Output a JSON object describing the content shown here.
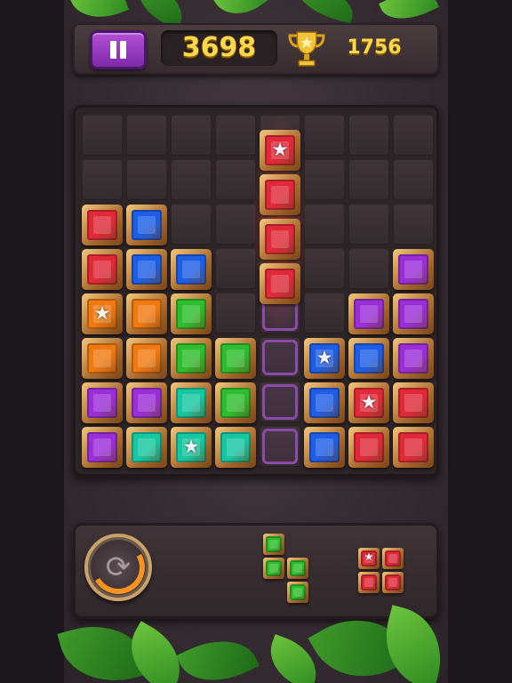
{
  "header": {
    "pause_icon": "pause-icon",
    "score": "3698",
    "trophy_icon": "trophy-icon",
    "best_score": "1756"
  },
  "colors": {
    "red": "#e02a3a",
    "blue": "#1e5ee6",
    "purple": "#9a2fd8",
    "orange": "#f07a12",
    "green": "#2ebd2e",
    "teal": "#17c7a2",
    "ghost": "#8a4aa8",
    "gold": "#ffd84a",
    "pause": "#9b3cc4",
    "rotate_accent": "#f7931e"
  },
  "board": {
    "rows": 8,
    "cols": 8,
    "placed": [
      {
        "row": 2,
        "col": 0,
        "color": "red"
      },
      {
        "row": 2,
        "col": 1,
        "color": "blue"
      },
      {
        "row": 3,
        "col": 0,
        "color": "red"
      },
      {
        "row": 3,
        "col": 1,
        "color": "blue"
      },
      {
        "row": 3,
        "col": 2,
        "color": "blue"
      },
      {
        "row": 3,
        "col": 7,
        "color": "purple"
      },
      {
        "row": 4,
        "col": 0,
        "color": "orange",
        "star": true
      },
      {
        "row": 4,
        "col": 1,
        "color": "orange"
      },
      {
        "row": 4,
        "col": 2,
        "color": "green"
      },
      {
        "row": 4,
        "col": 6,
        "color": "purple"
      },
      {
        "row": 4,
        "col": 7,
        "color": "purple"
      },
      {
        "row": 5,
        "col": 0,
        "color": "orange"
      },
      {
        "row": 5,
        "col": 1,
        "color": "orange"
      },
      {
        "row": 5,
        "col": 2,
        "color": "green"
      },
      {
        "row": 5,
        "col": 3,
        "color": "green"
      },
      {
        "row": 5,
        "col": 5,
        "color": "blue",
        "star": true
      },
      {
        "row": 5,
        "col": 6,
        "color": "blue"
      },
      {
        "row": 5,
        "col": 7,
        "color": "purple"
      },
      {
        "row": 6,
        "col": 0,
        "color": "purple"
      },
      {
        "row": 6,
        "col": 1,
        "color": "purple"
      },
      {
        "row": 6,
        "col": 2,
        "color": "teal"
      },
      {
        "row": 6,
        "col": 3,
        "color": "green"
      },
      {
        "row": 6,
        "col": 5,
        "color": "blue"
      },
      {
        "row": 6,
        "col": 6,
        "color": "red",
        "star": true
      },
      {
        "row": 6,
        "col": 7,
        "color": "red"
      },
      {
        "row": 7,
        "col": 0,
        "color": "purple"
      },
      {
        "row": 7,
        "col": 1,
        "color": "teal"
      },
      {
        "row": 7,
        "col": 2,
        "color": "teal",
        "star": true
      },
      {
        "row": 7,
        "col": 3,
        "color": "teal"
      },
      {
        "row": 7,
        "col": 5,
        "color": "blue"
      },
      {
        "row": 7,
        "col": 6,
        "color": "red"
      },
      {
        "row": 7,
        "col": 7,
        "color": "red"
      }
    ],
    "dragging_piece": {
      "color": "red",
      "cells": [
        {
          "row": 0,
          "col": 4,
          "star": true
        },
        {
          "row": 1,
          "col": 4
        },
        {
          "row": 2,
          "col": 4
        },
        {
          "row": 3,
          "col": 4
        }
      ]
    },
    "ghost_cells": [
      {
        "row": 4,
        "col": 4
      },
      {
        "row": 5,
        "col": 4
      },
      {
        "row": 6,
        "col": 4
      },
      {
        "row": 7,
        "col": 4
      }
    ]
  },
  "tray": {
    "rotate_icon": "rotate-icon",
    "pieces": [
      {
        "name": "green-s-piece",
        "color": "green",
        "cells": [
          {
            "r": 0,
            "c": 0
          },
          {
            "r": 1,
            "c": 0
          },
          {
            "r": 1,
            "c": 1
          },
          {
            "r": 2,
            "c": 1
          }
        ]
      },
      {
        "name": "red-square-piece",
        "color": "red",
        "cells": [
          {
            "r": 0,
            "c": 0,
            "star": true
          },
          {
            "r": 0,
            "c": 1
          },
          {
            "r": 1,
            "c": 0
          },
          {
            "r": 1,
            "c": 1
          }
        ]
      }
    ]
  }
}
